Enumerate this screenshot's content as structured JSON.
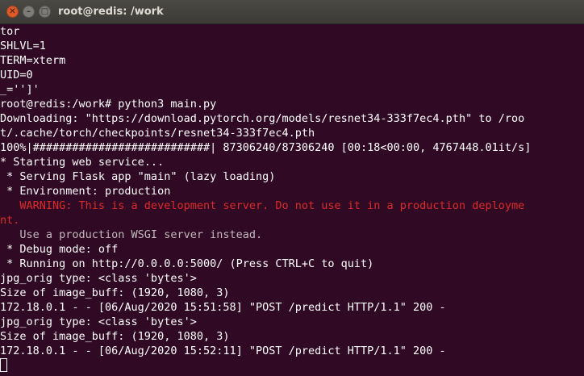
{
  "window": {
    "title": "root@redis: /work",
    "close_glyph": "✕",
    "minimize_glyph": "–",
    "maximize_glyph": "□"
  },
  "colors": {
    "background": "#300a24",
    "text": "#ffffff",
    "warning": "#dc2a2a",
    "titlebar": "#3c3b37",
    "close_button": "#dd5a2a"
  },
  "terminal": {
    "lines": [
      "tor",
      "SHLVL=1",
      "TERM=xterm",
      "UID=0",
      "_='']'",
      "root@redis:/work# python3 main.py",
      "Downloading: \"https://download.pytorch.org/models/resnet34-333f7ec4.pth\" to /roo",
      "t/.cache/torch/checkpoints/resnet34-333f7ec4.pth",
      "100%|###########################| 87306240/87306240 [00:18<00:00, 4767448.01it/s]",
      "* Starting web service...",
      " * Serving Flask app \"main\" (lazy loading)",
      " * Environment: production",
      "   WARNING: This is a development server. Do not use it in a production deployme",
      "nt.",
      "   Use a production WSGI server instead.",
      " * Debug mode: off",
      " * Running on http://0.0.0.0:5000/ (Press CTRL+C to quit)",
      "jpg_orig type: <class 'bytes'>",
      "Size of image_buff: (1920, 1080, 3)",
      "172.18.0.1 - - [06/Aug/2020 15:51:58] \"POST /predict HTTP/1.1\" 200 -",
      "jpg_orig type: <class 'bytes'>",
      "Size of image_buff: (1920, 1080, 3)",
      "172.18.0.1 - - [06/Aug/2020 15:52:11] \"POST /predict HTTP/1.1\" 200 -"
    ]
  }
}
